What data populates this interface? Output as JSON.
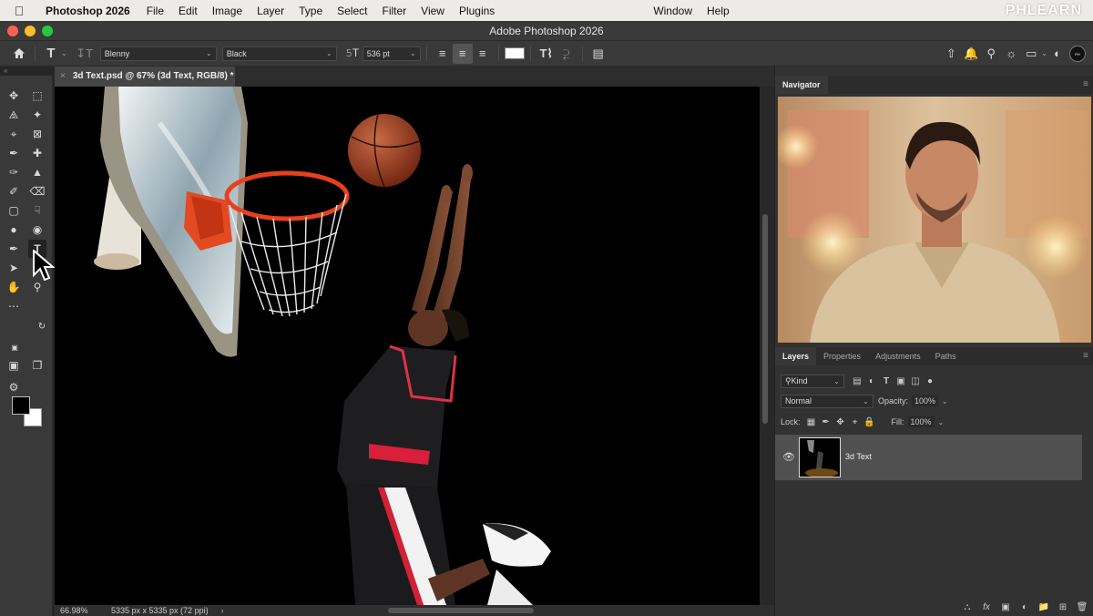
{
  "menubar": {
    "apple": "",
    "app_name": "Photoshop 2026",
    "menus": [
      "File",
      "Edit",
      "Image",
      "Layer",
      "Type",
      "Select",
      "Filter",
      "View",
      "Plugins"
    ],
    "right_menus": [
      "Window",
      "Help"
    ],
    "brand": "PHLEARN"
  },
  "window": {
    "title": "Adobe Photoshop 2026"
  },
  "options": {
    "font_family": "Blenny",
    "font_style": "Black",
    "font_size": "536 pt",
    "color_swatch": "#ffffff"
  },
  "document": {
    "tab_title": "3d Text.psd @ 67% (3d Text, RGB/8) *",
    "zoom": "66.98%",
    "dimensions": "5335 px x 5335 px (72 ppi)"
  },
  "navigator": {
    "title": "Navigator"
  },
  "layers_panel": {
    "tabs": [
      "Layers",
      "Properties",
      "Adjustments",
      "Paths"
    ],
    "filter_kind": "Kind",
    "blend_mode": "Normal",
    "opacity_label": "Opacity:",
    "opacity": "100%",
    "lock_label": "Lock:",
    "fill_label": "Fill:",
    "fill": "100%",
    "layers": [
      {
        "name": "3d Text",
        "visible": true
      }
    ]
  },
  "colors": {
    "foreground": "#000000",
    "background": "#ffffff",
    "ui_dark": "#323232",
    "hoop_orange": "#e8401c"
  }
}
